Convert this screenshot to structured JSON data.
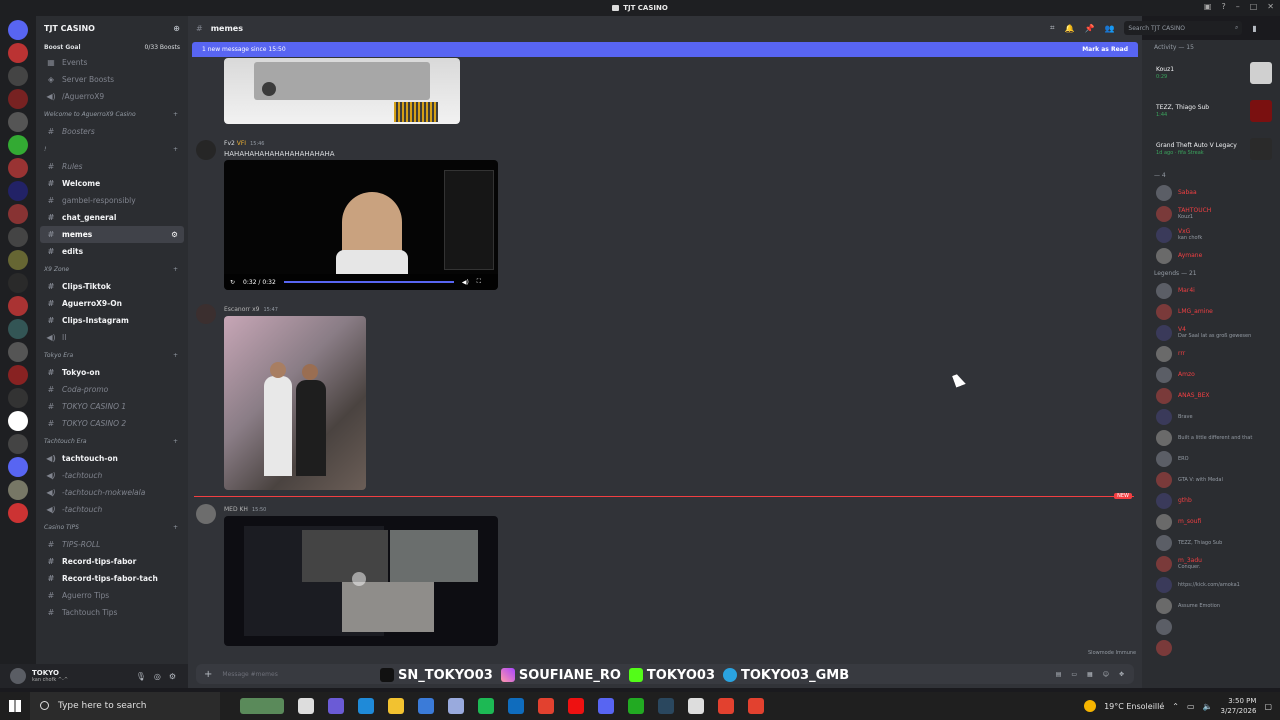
{
  "window": {
    "title": "TJT CASINO"
  },
  "server": {
    "name": "TJT CASINO",
    "boost_goal_label": "Boost Goal",
    "boost_count": "0/33 Boosts",
    "top_items": [
      "Events",
      "Server Boosts"
    ],
    "categories": [
      {
        "title": "",
        "channels": [
          {
            "label": "/AguerroX9",
            "style": "normal",
            "kind": "voice"
          }
        ]
      },
      {
        "title": "Welcome to AguerroX9 Casino",
        "channels": [
          {
            "label": "Boosters",
            "style": "italic",
            "kind": "text"
          }
        ]
      },
      {
        "title": "!",
        "channels": [
          {
            "label": "Rules",
            "style": "italic",
            "kind": "text"
          },
          {
            "label": "Welcome",
            "style": "bold",
            "kind": "text"
          },
          {
            "label": "gambel-responsibly",
            "style": "normal",
            "kind": "text"
          },
          {
            "label": "chat_general",
            "style": "bold",
            "kind": "text"
          },
          {
            "label": "memes",
            "style": "active",
            "kind": "text"
          },
          {
            "label": "edits",
            "style": "bold",
            "kind": "text"
          }
        ]
      },
      {
        "title": "X9 Zone",
        "channels": [
          {
            "label": "Clips-Tiktok",
            "style": "bold",
            "kind": "text"
          },
          {
            "label": "AguerroX9-On",
            "style": "bold",
            "kind": "text"
          },
          {
            "label": "Clips-Instagram",
            "style": "bold",
            "kind": "text"
          },
          {
            "label": "II",
            "style": "normal",
            "kind": "voice"
          }
        ]
      },
      {
        "title": "Tokyo Era",
        "channels": [
          {
            "label": "Tokyo-on",
            "style": "bold",
            "kind": "text"
          },
          {
            "label": "Coda-promo",
            "style": "italic",
            "kind": "text"
          },
          {
            "label": "TOKYO CASINO 1",
            "style": "italic",
            "kind": "text"
          },
          {
            "label": "TOKYO CASINO 2",
            "style": "italic",
            "kind": "text"
          }
        ]
      },
      {
        "title": "Tachtouch Era",
        "channels": [
          {
            "label": "tachtouch-on",
            "style": "bold",
            "kind": "voice"
          },
          {
            "label": "-tachtouch",
            "style": "italic",
            "kind": "voice"
          },
          {
            "label": "-tachtouch-mokwelala",
            "style": "italic",
            "kind": "voice"
          },
          {
            "label": "-tachtouch",
            "style": "italic",
            "kind": "voice"
          }
        ]
      },
      {
        "title": "Casino TIPS",
        "channels": [
          {
            "label": "TIPS-ROLL",
            "style": "italic",
            "kind": "text"
          },
          {
            "label": "Record-tips-fabor",
            "style": "bold",
            "kind": "text"
          },
          {
            "label": "Record-tips-fabor-tach",
            "style": "bold",
            "kind": "text"
          },
          {
            "label": "Aguerro Tips",
            "style": "normal",
            "kind": "text"
          },
          {
            "label": "Tachtouch Tips",
            "style": "normal",
            "kind": "text"
          }
        ]
      }
    ]
  },
  "user": {
    "name": "TOKYO",
    "status": "kan chofk ^-^"
  },
  "channel_header": {
    "name": "memes",
    "search_placeholder": "Search TJT CASINO"
  },
  "new_banner": {
    "text": "1 new message since 15:50",
    "action": "Mark as Read"
  },
  "messages": [
    {
      "author": "Fv2",
      "badge": "VFI",
      "time": "15:46",
      "text": "HAHAHAHAHAHAHAHAHAHAHA",
      "video_time": "0:32 / 0:32"
    },
    {
      "author": "Escanorr x9",
      "time": "15:47",
      "text": ""
    },
    {
      "author": "MED KH",
      "time": "15:50",
      "text": "",
      "new_label": "NEW"
    }
  ],
  "composer": {
    "placeholder": "Message #memes",
    "slowmode": "Slowmode Immune"
  },
  "overlay_socials": [
    "SN_TOKYO03",
    "SOUFIANE_RO",
    "TOKYO03",
    "TOKYO03_GMB"
  ],
  "members": {
    "activity_header": "Activity — 15",
    "activities": [
      {
        "name": "Kouz1",
        "sub": "0:29"
      },
      {
        "name": "TEZZ, Thiago Sub",
        "sub": "1:44"
      },
      {
        "name": "Grand Theft Auto V Legacy",
        "sub": "1d ago · fifa Streak"
      }
    ],
    "group1_header": "— 4",
    "group1": [
      {
        "name": "Sabaa",
        "sub": ""
      },
      {
        "name": "TAHTOUCH",
        "sub": "Kouz1"
      },
      {
        "name": "VxG",
        "sub": "kan chofk"
      },
      {
        "name": "Aymane",
        "sub": ""
      }
    ],
    "legends_header": "Legends — 21",
    "legends": [
      {
        "name": "Mar4i",
        "sub": ""
      },
      {
        "name": "LMG_amine",
        "sub": ""
      },
      {
        "name": "V4",
        "sub": "Dar Saal lat as groß gewesen"
      },
      {
        "name": "rrr",
        "sub": ""
      },
      {
        "name": "Amzo",
        "sub": ""
      },
      {
        "name": "ANAS_BEX",
        "sub": ""
      },
      {
        "name": "",
        "sub": "Brave"
      },
      {
        "name": "",
        "sub": "Built a little different and that"
      },
      {
        "name": "",
        "sub": "ERO"
      },
      {
        "name": "",
        "sub": "GTA V: with Medal"
      },
      {
        "name": "gthb",
        "sub": ""
      },
      {
        "name": "m_soufi",
        "sub": ""
      },
      {
        "name": "",
        "sub": "TEZZ, Thiago Sub"
      },
      {
        "name": "m_3adu",
        "sub": "Conquer."
      },
      {
        "name": "",
        "sub": "https://kick.com/amoka1"
      },
      {
        "name": "",
        "sub": "Assume Emotion"
      },
      {
        "name": "",
        "sub": ""
      },
      {
        "name": "",
        "sub": ""
      }
    ]
  },
  "taskbar": {
    "search": "Type here to search",
    "weather": "19°C  Ensoleillé",
    "time": "3:50 PM",
    "date": "3/27/2026"
  },
  "colors": {
    "accent": "#5865f2",
    "red": "#f23f42",
    "green": "#3ba55d"
  }
}
